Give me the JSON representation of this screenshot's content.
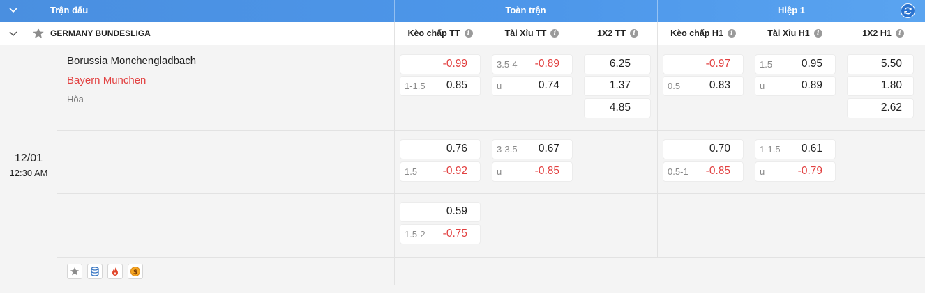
{
  "header": {
    "match_label": "Trận đấu",
    "full_label": "Toàn trận",
    "half_label": "Hiệp 1"
  },
  "league": {
    "name": "GERMANY BUNDESLIGA",
    "columns": [
      "Kèo chấp TT",
      "Tài Xỉu TT",
      "1X2 TT",
      "Kèo chấp H1",
      "Tài Xỉu H1",
      "1X2 H1"
    ]
  },
  "match": {
    "date": "12/01",
    "time": "12:30 AM",
    "home": "Borussia Monchengladbach",
    "away": "Bayern Munchen",
    "draw": "Hòa"
  },
  "odds": {
    "r1": {
      "hc_tt": [
        {
          "line": "",
          "value": "-0.99"
        },
        {
          "line": "1-1.5",
          "value": "0.85"
        }
      ],
      "ou_tt": [
        {
          "line": "3.5-4",
          "value": "-0.89"
        },
        {
          "line": "u",
          "value": "0.74"
        }
      ],
      "x12_tt": [
        "6.25",
        "1.37",
        "4.85"
      ],
      "hc_h1": [
        {
          "line": "",
          "value": "-0.97"
        },
        {
          "line": "0.5",
          "value": "0.83"
        }
      ],
      "ou_h1": [
        {
          "line": "1.5",
          "value": "0.95"
        },
        {
          "line": "u",
          "value": "0.89"
        }
      ],
      "x12_h1": [
        "5.50",
        "1.80",
        "2.62"
      ]
    },
    "r2": {
      "hc_tt": [
        {
          "line": "",
          "value": "0.76"
        },
        {
          "line": "1.5",
          "value": "-0.92"
        }
      ],
      "ou_tt": [
        {
          "line": "3-3.5",
          "value": "0.67"
        },
        {
          "line": "u",
          "value": "-0.85"
        }
      ],
      "hc_h1": [
        {
          "line": "",
          "value": "0.70"
        },
        {
          "line": "0.5-1",
          "value": "-0.85"
        }
      ],
      "ou_h1": [
        {
          "line": "1-1.5",
          "value": "0.61"
        },
        {
          "line": "u",
          "value": "-0.79"
        }
      ]
    },
    "r3": {
      "hc_tt": [
        {
          "line": "",
          "value": "0.59"
        },
        {
          "line": "1.5-2",
          "value": "-0.75"
        }
      ]
    }
  },
  "colors": {
    "header_bg": "#4a8fe0",
    "negative": "#e24141",
    "away_team": "#e24141"
  },
  "icons": [
    "star-icon",
    "database-icon",
    "fire-icon",
    "coin-icon"
  ]
}
